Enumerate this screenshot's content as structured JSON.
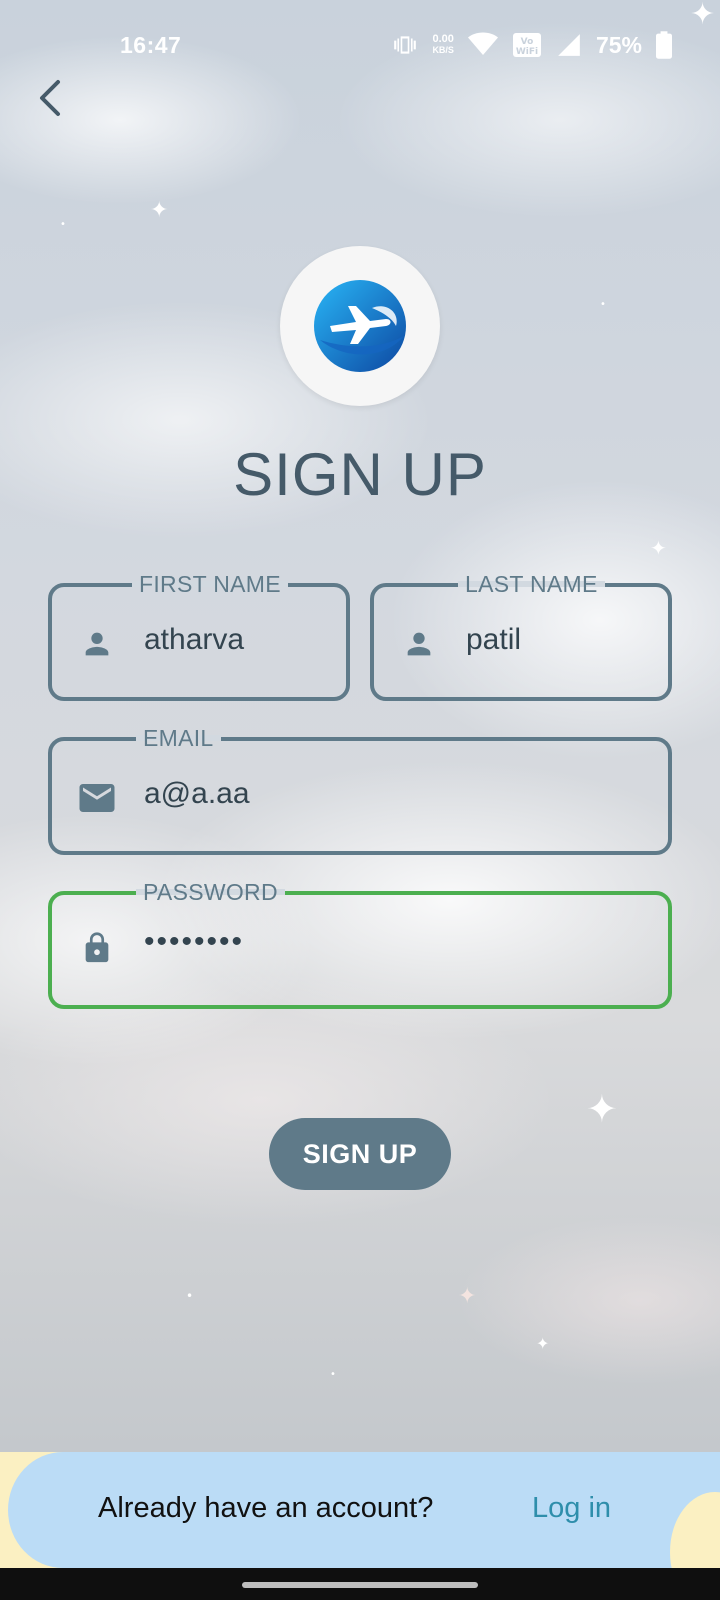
{
  "status_bar": {
    "time": "16:47",
    "net_speed_value": "0.00",
    "net_speed_unit": "KB/S",
    "battery_percent": "75%",
    "icons": [
      "vibrate-icon",
      "wifi-icon",
      "vowifi-icon",
      "signal-icon",
      "battery-icon"
    ]
  },
  "header": {
    "back_icon": "chevron-left-icon",
    "title": "SIGN UP"
  },
  "form": {
    "first_name": {
      "label": "FIRST NAME",
      "value": "atharva",
      "icon": "person-icon"
    },
    "last_name": {
      "label": "LAST NAME",
      "value": "patil",
      "icon": "person-icon"
    },
    "email": {
      "label": "EMAIL",
      "value": "a@a.aa",
      "icon": "mail-icon"
    },
    "password": {
      "label": "PASSWORD",
      "value": "••••••••",
      "icon": "lock-icon"
    },
    "submit_label": "SIGN UP"
  },
  "footer": {
    "prompt": "Already have an account?",
    "login_label": "Log in"
  },
  "colors": {
    "field_border": "#5f7a89",
    "field_active": "#4caf50",
    "button_bg": "#5f7a89",
    "title": "#455a69",
    "link": "#2e8eab",
    "footer_bg": "#bbdcf6",
    "footer_accent": "#fbf0c2"
  }
}
